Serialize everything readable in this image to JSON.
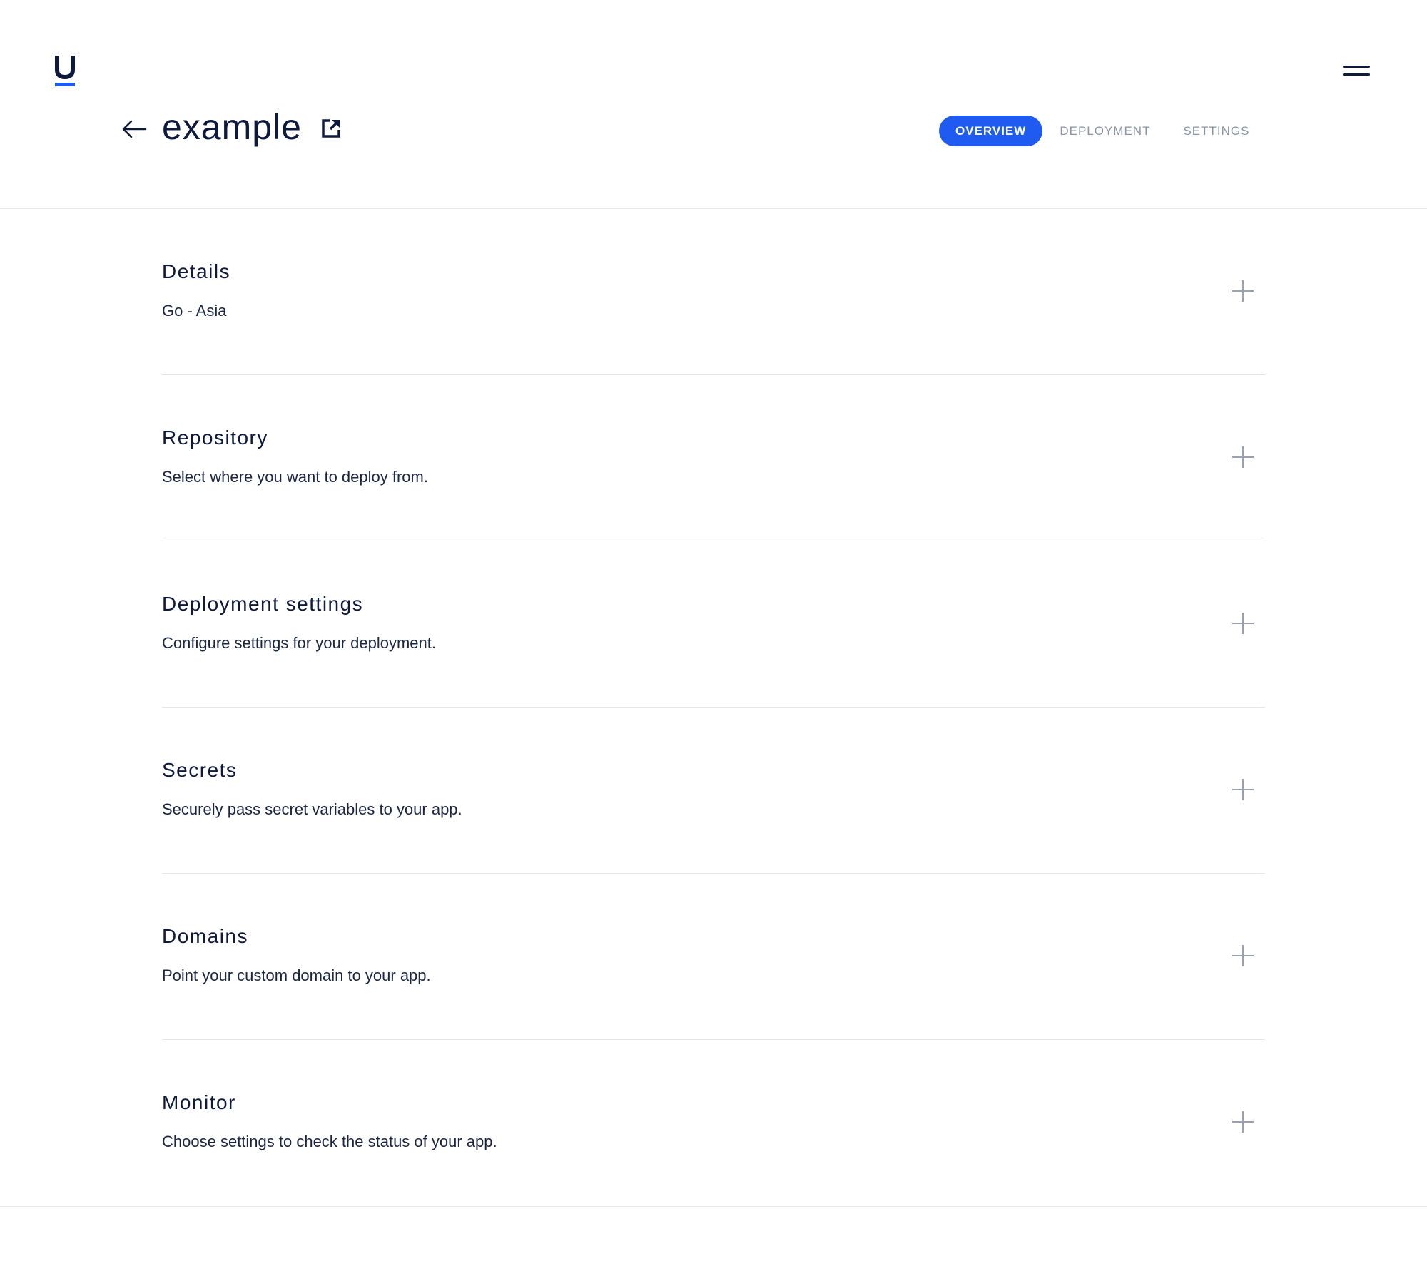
{
  "app": {
    "logo_letter": "U",
    "logo_icon": "u-logo-icon",
    "menu_icon": "hamburger-menu-icon",
    "accent_color": "#1f5bf0",
    "text_color": "#0e1a3d"
  },
  "header": {
    "back_icon": "arrow-left-icon",
    "title": "example",
    "external_icon": "external-link-icon"
  },
  "tabs": [
    {
      "label": "OVERVIEW",
      "active": true
    },
    {
      "label": "DEPLOYMENT",
      "active": false
    },
    {
      "label": "SETTINGS",
      "active": false
    }
  ],
  "sections": [
    {
      "title": "Details",
      "description": "Go - Asia",
      "action_icon": "plus-icon"
    },
    {
      "title": "Repository",
      "description": "Select where you want to deploy from.",
      "action_icon": "plus-icon"
    },
    {
      "title": "Deployment settings",
      "description": "Configure settings for your deployment.",
      "action_icon": "plus-icon"
    },
    {
      "title": "Secrets",
      "description": "Securely pass secret variables to your app.",
      "action_icon": "plus-icon"
    },
    {
      "title": "Domains",
      "description": "Point your custom domain to your app.",
      "action_icon": "plus-icon"
    },
    {
      "title": "Monitor",
      "description": "Choose settings to check the status of your app.",
      "action_icon": "plus-icon"
    }
  ]
}
